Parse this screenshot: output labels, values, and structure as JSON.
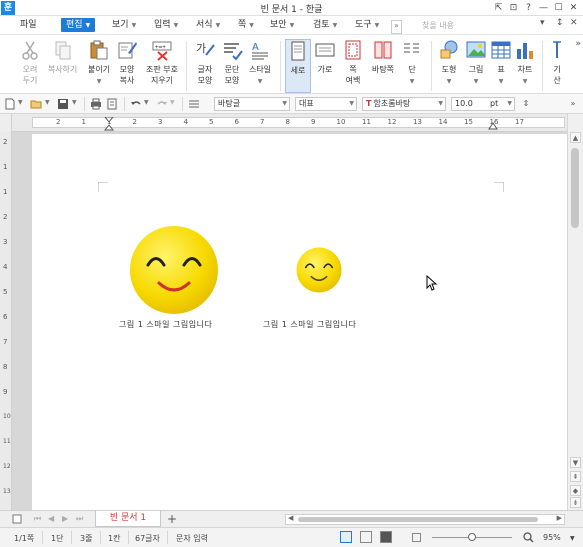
{
  "window": {
    "app_icon": "훈",
    "title": "빈 문서 1 - 한글",
    "controls": [
      "⇱",
      "⊡",
      "?",
      "—",
      "☐",
      "✕"
    ]
  },
  "menu": {
    "file": "파일",
    "items": [
      "편집",
      "보기",
      "입력",
      "서식",
      "쪽",
      "보안",
      "검토",
      "도구"
    ],
    "active_index": 0,
    "expand": "»",
    "search_placeholder": "찾을 내용",
    "right_controls": [
      "▾",
      "↕",
      "✕"
    ]
  },
  "ribbon": {
    "cut": "오려\n두기",
    "copy": "복사하기",
    "paste": "붙이기",
    "format_copy": "모양\n복사",
    "clear_format": "조판 부호\n지우기",
    "char_shape": "글자\n모양",
    "para_shape": "문단\n모양",
    "style": "스타일",
    "portrait": "세로",
    "landscape": "가로",
    "margins": "쪽\n여백",
    "background": "바탕쪽",
    "columns": "단",
    "shape": "도형",
    "picture": "그림",
    "table": "표",
    "chart": "차트",
    "more": "기\n산",
    "expand": "»"
  },
  "format_toolbar": {
    "style": "바탕글",
    "language": "대표",
    "font": "함초롬바탕",
    "font_icon": "T",
    "size": "10.0",
    "unit": "pt"
  },
  "ruler": {
    "h_numbers": [
      "2",
      "1",
      "1",
      "2",
      "3",
      "4",
      "5",
      "6",
      "7",
      "8",
      "9",
      "10",
      "11",
      "12",
      "13",
      "14",
      "15",
      "16",
      "17"
    ],
    "v_numbers": [
      "2",
      "1",
      "1",
      "2",
      "3",
      "4",
      "5",
      "6",
      "7",
      "8",
      "9",
      "10",
      "11",
      "12",
      "13",
      "14"
    ]
  },
  "document": {
    "caption_1": "그림 1  스마일 그림입니다",
    "caption_2": "그림 1  스마일 그림입니다",
    "smiley_color": "#f7d900"
  },
  "tabs": {
    "current": "빈 문서 1",
    "add": "+"
  },
  "status": {
    "page": "1/1쪽",
    "section": "1단",
    "line": "3줄",
    "column": "1칸",
    "chars": "67글자",
    "mode": "문자 입력",
    "zoom": "95%",
    "zoom_level": 0.5
  },
  "colors": {
    "accent": "#1f7bd6",
    "tab_text": "#dd3333"
  }
}
